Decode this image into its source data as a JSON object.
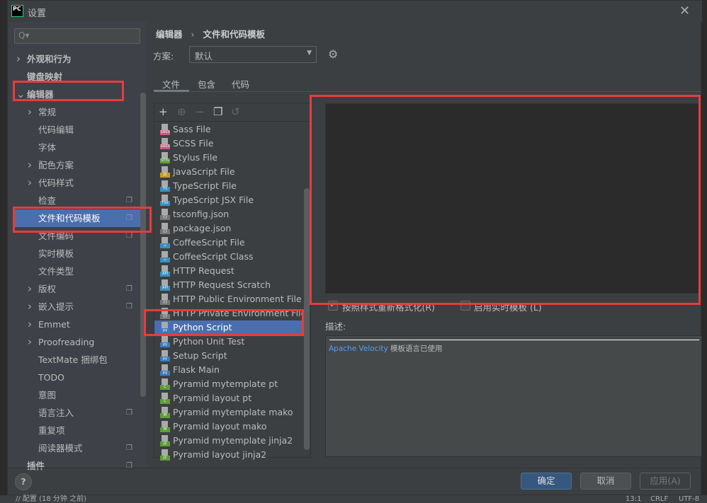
{
  "window": {
    "title": "设置",
    "logo": "PC"
  },
  "search": {
    "placeholder": "Q▾"
  },
  "sidebar": {
    "items": [
      {
        "label": "外观和行为",
        "level": 0,
        "chevron": "right"
      },
      {
        "label": "键盘映射",
        "level": 0
      },
      {
        "label": "编辑器",
        "level": 0,
        "chevron": "down"
      },
      {
        "label": "常规",
        "level": 1,
        "chevron": "right"
      },
      {
        "label": "代码编辑",
        "level": 1
      },
      {
        "label": "字体",
        "level": 1
      },
      {
        "label": "配色方案",
        "level": 1,
        "chevron": "right"
      },
      {
        "label": "代码样式",
        "level": 1,
        "chevron": "right"
      },
      {
        "label": "检查",
        "level": 1,
        "copy": true
      },
      {
        "label": "文件和代码模板",
        "level": 1,
        "selected": true,
        "copy": true
      },
      {
        "label": "文件编码",
        "level": 1,
        "copy": true
      },
      {
        "label": "实时模板",
        "level": 1
      },
      {
        "label": "文件类型",
        "level": 1
      },
      {
        "label": "版权",
        "level": 1,
        "chevron": "right",
        "copy": true
      },
      {
        "label": "嵌入提示",
        "level": 1,
        "chevron": "right",
        "copy": true
      },
      {
        "label": "Emmet",
        "level": 1,
        "chevron": "right"
      },
      {
        "label": "Proofreading",
        "level": 1,
        "chevron": "right"
      },
      {
        "label": "TextMate 捆绑包",
        "level": 1
      },
      {
        "label": "TODO",
        "level": 1
      },
      {
        "label": "意图",
        "level": 1
      },
      {
        "label": "语言注入",
        "level": 1,
        "copy": true
      },
      {
        "label": "重复项",
        "level": 1
      },
      {
        "label": "阅读器模式",
        "level": 1,
        "copy": true
      },
      {
        "label": "插件",
        "level": 0,
        "copy": true
      }
    ]
  },
  "breadcrumb": {
    "parent": "编辑器",
    "sep": "›",
    "current": "文件和代码模板"
  },
  "scheme": {
    "label": "方案:",
    "value": "默认"
  },
  "tabs": [
    {
      "label": "文件",
      "selected": true
    },
    {
      "label": "包含"
    },
    {
      "label": "代码"
    }
  ],
  "toolbar": {
    "add": "+",
    "add_child": "⊕",
    "remove": "−",
    "copy": "❐",
    "reset": "↺"
  },
  "files": [
    {
      "label": "Sass File",
      "badge": "SASS",
      "color": "#c9587b"
    },
    {
      "label": "SCSS File",
      "badge": "SASS",
      "color": "#c9587b"
    },
    {
      "label": "Stylus File",
      "badge": "STYL",
      "color": "#5f9e3a"
    },
    {
      "label": "JavaScript File",
      "badge": "JS",
      "color": "#c99a2e"
    },
    {
      "label": "TypeScript File",
      "badge": "TS",
      "color": "#3a8fbf"
    },
    {
      "label": "TypeScript JSX File",
      "badge": "TSX",
      "color": "#3a8fbf"
    },
    {
      "label": "tsconfig.json",
      "badge": "{}",
      "color": "#777777"
    },
    {
      "label": "package.json",
      "badge": "{}",
      "color": "#777777"
    },
    {
      "label": "CoffeeScript File",
      "badge": "☕",
      "color": "#3a8fbf"
    },
    {
      "label": "CoffeeScript Class",
      "badge": "☕",
      "color": "#3a8fbf"
    },
    {
      "label": "HTTP Request",
      "badge": "API",
      "color": "#3a8fbf"
    },
    {
      "label": "HTTP Request Scratch",
      "badge": "API",
      "color": "#3a8fbf"
    },
    {
      "label": "HTTP Public Environment File",
      "badge": "{}",
      "color": "#777777"
    },
    {
      "label": "HTTP Private Environment File",
      "badge": "{}",
      "color": "#777777"
    },
    {
      "label": "Python Script",
      "badge": "py",
      "color": "#3a7bbf",
      "selected": true
    },
    {
      "label": "Python Unit Test",
      "badge": "py",
      "color": "#3a7bbf"
    },
    {
      "label": "Setup Script",
      "badge": "py",
      "color": "#3a7bbf"
    },
    {
      "label": "Flask Main",
      "badge": "py",
      "color": "#3a7bbf"
    },
    {
      "label": "Pyramid mytemplate pt",
      "badge": "C",
      "color": "#5f9e3a"
    },
    {
      "label": "Pyramid layout pt",
      "badge": "C",
      "color": "#5f9e3a"
    },
    {
      "label": "Pyramid mytemplate mako",
      "badge": "M",
      "color": "#5f9e3a"
    },
    {
      "label": "Pyramid layout mako",
      "badge": "M",
      "color": "#5f9e3a"
    },
    {
      "label": "Pyramid mytemplate jinja2",
      "badge": "J2",
      "color": "#5f9e3a"
    },
    {
      "label": "Pyramid layout jinja2",
      "badge": "J2",
      "color": "#5f9e3a"
    }
  ],
  "options": {
    "reformat": {
      "label": "按照样式重新格式化(R)",
      "checked": true
    },
    "live": {
      "label": "启用实时模板 (L)",
      "checked": false
    }
  },
  "description": {
    "label": "描述:",
    "link": "Apache Velocity",
    "text": " 模板语言已使用",
    "link_color": "#589df6"
  },
  "buttons": {
    "ok": "确定",
    "cancel": "取消",
    "apply": "应用(A)",
    "help": "?"
  },
  "statusbar": {
    "left": "// 配置 (18 分钟 之前)",
    "pos": "13:1",
    "eol": "CRLF",
    "enc": "UTF-8"
  },
  "colors": {
    "accent": "#4b6eaf",
    "highlight": "#e83c3c"
  }
}
